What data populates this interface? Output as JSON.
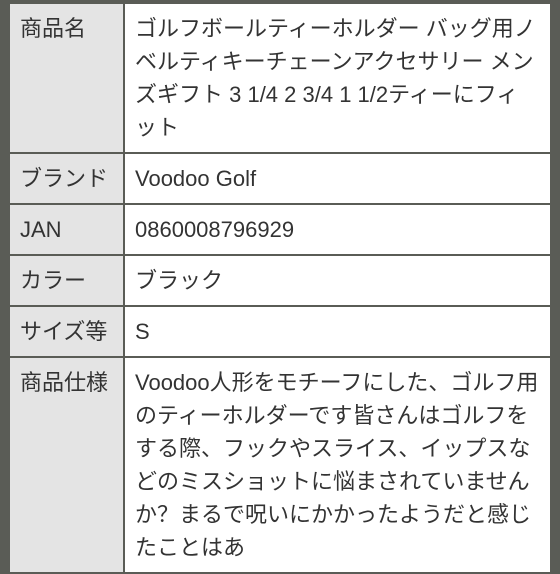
{
  "rows": [
    {
      "label": "商品名",
      "value": "ゴルフボールティーホルダー バッグ用ノベルティキーチェーンアクセサリー メンズギフト 3 1/4 2 3/4 1 1/2ティーにフィット"
    },
    {
      "label": "ブランド",
      "value": "Voodoo Golf"
    },
    {
      "label": "JAN",
      "value": "0860008796929"
    },
    {
      "label": "カラー",
      "value": "ブラック"
    },
    {
      "label": "サイズ等",
      "value": "S"
    },
    {
      "label": "商品仕様",
      "value": "Voodoo人形をモチーフにした、ゴルフ用のティーホルダーです皆さんはゴルフをする際、フックやスライス、イップスなどのミスショットに悩まされていませんか？まるで呪いにかかったようだと感じたことはあ"
    }
  ]
}
